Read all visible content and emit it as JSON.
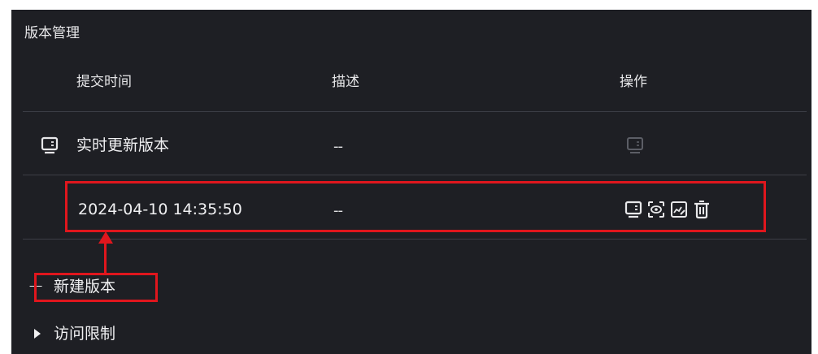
{
  "panel": {
    "title": "版本管理"
  },
  "table": {
    "columns": {
      "submit_time": "提交时间",
      "description": "描述",
      "actions": "操作"
    },
    "rows": [
      {
        "name": "实时更新版本",
        "description": "--",
        "icon": "display-icon",
        "actions": [
          "display-icon"
        ]
      },
      {
        "name": "2024-04-10 14:35:50",
        "description": "--",
        "actions": [
          "display-icon",
          "preview-icon",
          "edit-icon",
          "delete-icon"
        ]
      }
    ]
  },
  "actions": {
    "new_version": "新建版本",
    "access_limit": "访问限制"
  },
  "colors": {
    "panel_bg": "#1e1f24",
    "divider": "#3c3e46",
    "text": "#f0f0f2",
    "highlight": "#e0161d",
    "disabled_icon": "#6a6c74"
  }
}
